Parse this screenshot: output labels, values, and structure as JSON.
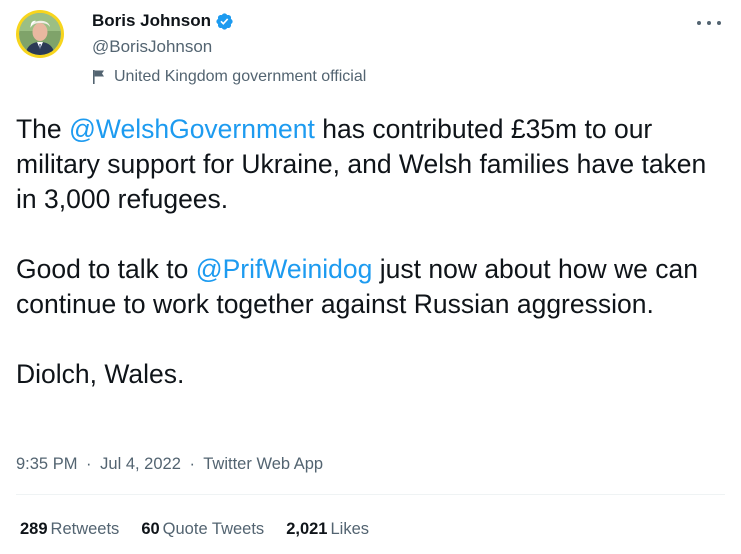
{
  "tweet": {
    "author": {
      "display_name": "Boris Johnson",
      "handle": "@BorisJohnson",
      "verified": true,
      "avatar_ring_color": "#f7d51d",
      "label": "United Kingdom government official",
      "label_icon": "flag-icon"
    },
    "more_icon": "more-horizontal-icon",
    "body": {
      "p1": {
        "t1": "The ",
        "mention1": "@WelshGovernment",
        "t2": " has contributed £35m to our military support for Ukraine, and Welsh families have taken in 3,000 refugees."
      },
      "p2": {
        "t1": "Good to talk to ",
        "mention1": "@PrifWeinidog",
        "t2": " just now about how we can continue to work together against Russian aggression."
      },
      "p3": "Diolch, Wales."
    },
    "meta": {
      "time": "9:35 PM",
      "sep1": "·",
      "date": "Jul 4, 2022",
      "sep2": "·",
      "source": "Twitter Web App"
    },
    "stats": {
      "retweets_count": "289",
      "retweets_label": "Retweets",
      "quotes_count": "60",
      "quotes_label": "Quote Tweets",
      "likes_count": "2,021",
      "likes_label": "Likes"
    },
    "colors": {
      "link": "#1d9bf0",
      "secondary_text": "#536471",
      "primary_text": "#0f1419",
      "verified_badge": "#1d9bf0"
    }
  }
}
